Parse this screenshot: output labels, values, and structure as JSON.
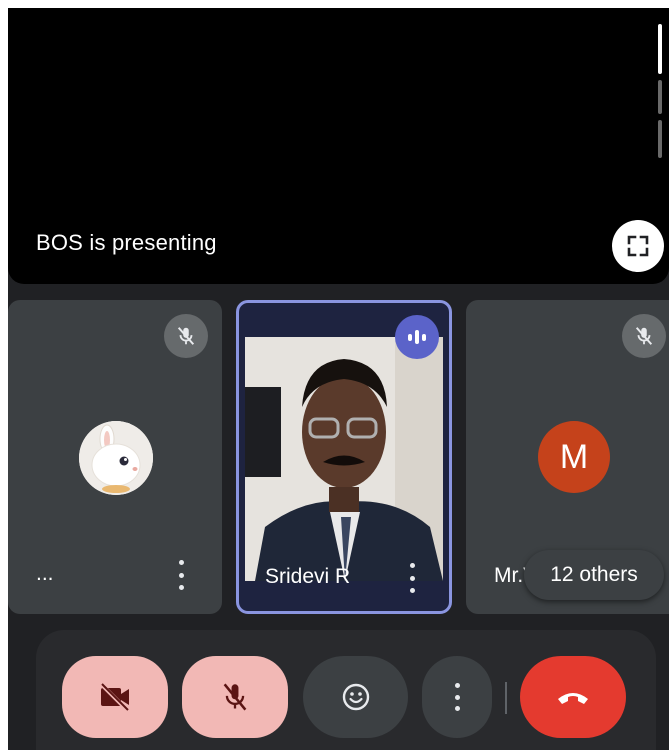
{
  "presentation": {
    "label": "BOS is presenting"
  },
  "tiles": [
    {
      "name": "...",
      "mic": "mic-off",
      "avatar": "rabbit"
    },
    {
      "name": "Sridevi R",
      "mic": "speaking"
    },
    {
      "name": "Mr.V",
      "mic": "mic-off",
      "avatar_letter": "M"
    }
  ],
  "others": {
    "label": "12 others"
  },
  "controls": {
    "camera": "camera-off-icon",
    "mic": "mic-off-icon",
    "reactions": "emoji-icon",
    "more": "more-options-icon",
    "end": "end-call-icon"
  },
  "colors": {
    "background": "#202124",
    "tile": "#3c4043",
    "speaking_border": "#8a95e0",
    "off_button": "#f2b8b5",
    "end_call": "#e43a2f",
    "avatar_m": "#c5421b"
  }
}
